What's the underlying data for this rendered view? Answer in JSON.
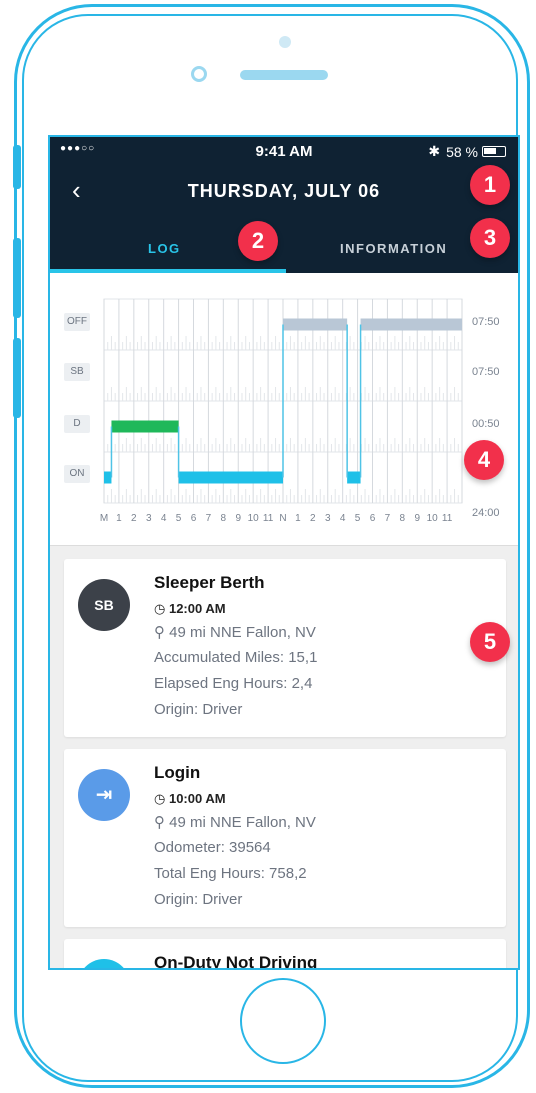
{
  "status_bar": {
    "signal": "●●●○○",
    "time": "9:41 AM",
    "bluetooth": "✱",
    "battery_text": "58 %",
    "battery_level": 0.58
  },
  "header": {
    "back_icon": "chevron-left-icon",
    "back_glyph": "‹",
    "title": "THURSDAY, JULY 06"
  },
  "tabs": [
    {
      "label": "LOG",
      "active": true
    },
    {
      "label": "INFORMATION",
      "active": false
    }
  ],
  "badges": [
    "1",
    "2",
    "3",
    "4",
    "5"
  ],
  "chart_data": {
    "type": "step",
    "rows": [
      "OFF",
      "SB",
      "D",
      "ON"
    ],
    "totals": [
      "07:50",
      "07:50",
      "00:50",
      "24:00"
    ],
    "x_ticks": [
      "M",
      "1",
      "2",
      "3",
      "4",
      "5",
      "6",
      "7",
      "8",
      "9",
      "10",
      "11",
      "N",
      "1",
      "2",
      "3",
      "4",
      "5",
      "6",
      "7",
      "8",
      "9",
      "10",
      "11"
    ],
    "x_range_hours": [
      0,
      24
    ],
    "segments": [
      {
        "status": "ON",
        "start": 0.0,
        "end": 0.5
      },
      {
        "status": "D",
        "start": 0.5,
        "end": 5.0
      },
      {
        "status": "ON",
        "start": 5.0,
        "end": 12.0
      },
      {
        "status": "OFF",
        "start": 12.0,
        "end": 16.3
      },
      {
        "status": "ON",
        "start": 16.3,
        "end": 17.2
      },
      {
        "status": "OFF",
        "start": 17.2,
        "end": 24.0
      }
    ],
    "colors": {
      "OFF": "#b9c7d6",
      "SB": "#b9c7d6",
      "D": "#1fb85a",
      "ON": "#1fc0e8",
      "connector": "#4fc3e6"
    }
  },
  "entries": [
    {
      "avatar_text": "SB",
      "avatar_color": "#3c4149",
      "title": "Sleeper Berth",
      "time": "12:00 AM",
      "location": "49 mi NNE Fallon, NV",
      "line1": "Accumulated Miles: 15,1",
      "line2": "Elapsed Eng Hours: 2,4",
      "line3": "Origin: Driver"
    },
    {
      "avatar_text": "⇥",
      "avatar_color": "#5a9be8",
      "title": "Login",
      "time": "10:00 AM",
      "location": "49 mi NNE Fallon, NV",
      "line1": "Odometer: 39564",
      "line2": "Total Eng Hours: 758,2",
      "line3": "Origin: Driver"
    },
    {
      "avatar_text": "",
      "avatar_color": "#1fc0e8",
      "title": "On-Duty Not Driving"
    }
  ],
  "icons": {
    "clock": "clock-icon",
    "location": "location-pin-icon"
  },
  "accent": "#29c4e8"
}
